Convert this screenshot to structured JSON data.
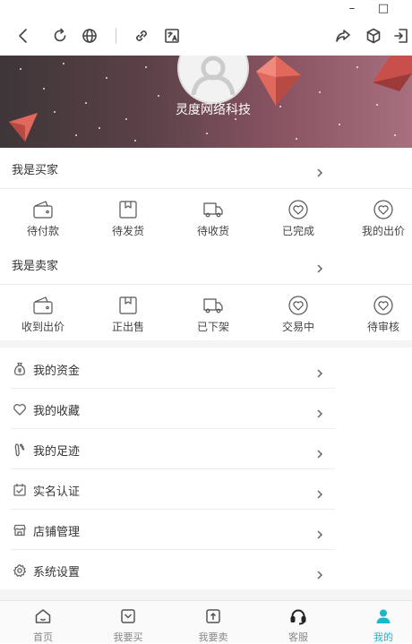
{
  "window": {
    "minimize": "–",
    "maximize": "□"
  },
  "profile": {
    "name": "灵度网络科技"
  },
  "buyer": {
    "title": "我是买家",
    "items": [
      {
        "label": "待付款",
        "icon": "wallet-icon"
      },
      {
        "label": "待发货",
        "icon": "package-icon"
      },
      {
        "label": "待收货",
        "icon": "truck-icon"
      },
      {
        "label": "已完成",
        "icon": "heart-icon"
      },
      {
        "label": "我的出价",
        "icon": "heart-icon"
      }
    ]
  },
  "seller": {
    "title": "我是卖家",
    "items": [
      {
        "label": "收到出价",
        "icon": "wallet-icon"
      },
      {
        "label": "正出售",
        "icon": "package-icon"
      },
      {
        "label": "已下架",
        "icon": "truck-icon"
      },
      {
        "label": "交易中",
        "icon": "heart-icon"
      },
      {
        "label": "待审核",
        "icon": "heart-icon"
      }
    ]
  },
  "menu": [
    {
      "label": "我的资金",
      "icon": "money-bag-icon"
    },
    {
      "label": "我的收藏",
      "icon": "heart-icon"
    },
    {
      "label": "我的足迹",
      "icon": "footprint-icon"
    },
    {
      "label": "实名认证",
      "icon": "id-check-icon"
    },
    {
      "label": "店铺管理",
      "icon": "store-icon"
    },
    {
      "label": "系统设置",
      "icon": "settings-icon"
    }
  ],
  "tabs": [
    {
      "label": "首页",
      "icon": "home-icon"
    },
    {
      "label": "我要买",
      "icon": "buy-icon"
    },
    {
      "label": "我要卖",
      "icon": "sell-icon"
    },
    {
      "label": "客服",
      "icon": "headset-icon"
    },
    {
      "label": "我的",
      "icon": "user-icon",
      "active": true
    }
  ],
  "colors": {
    "accent": "#19b7c7",
    "banner_from": "#3e3638",
    "banner_to": "#a8707e"
  }
}
